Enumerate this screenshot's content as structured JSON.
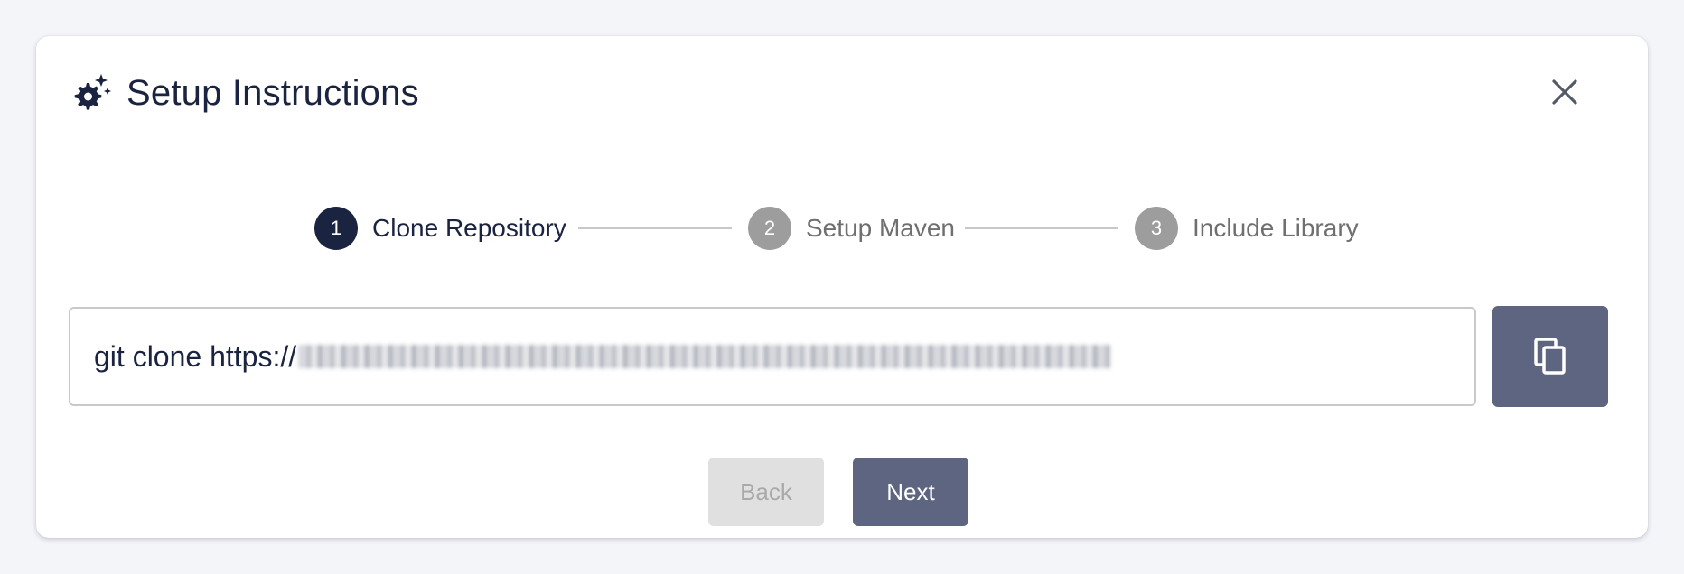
{
  "dialog": {
    "title": "Setup Instructions",
    "header_icon": "gear-sparkle-icon",
    "close_icon": "close-icon"
  },
  "stepper": {
    "steps": [
      {
        "number": "1",
        "label": "Clone Repository",
        "state": "active"
      },
      {
        "number": "2",
        "label": "Setup Maven",
        "state": "inactive"
      },
      {
        "number": "3",
        "label": "Include Library",
        "state": "inactive"
      }
    ]
  },
  "command": {
    "prefix": "git clone https://",
    "url_redacted": "redacted-repository-url",
    "copy_icon": "copy-icon"
  },
  "actions": {
    "back_label": "Back",
    "next_label": "Next"
  },
  "colors": {
    "primary_dark": "#1a2340",
    "button": "#5e6580",
    "inactive_step": "#9d9d9d",
    "disabled_bg": "#e0e0e0"
  }
}
